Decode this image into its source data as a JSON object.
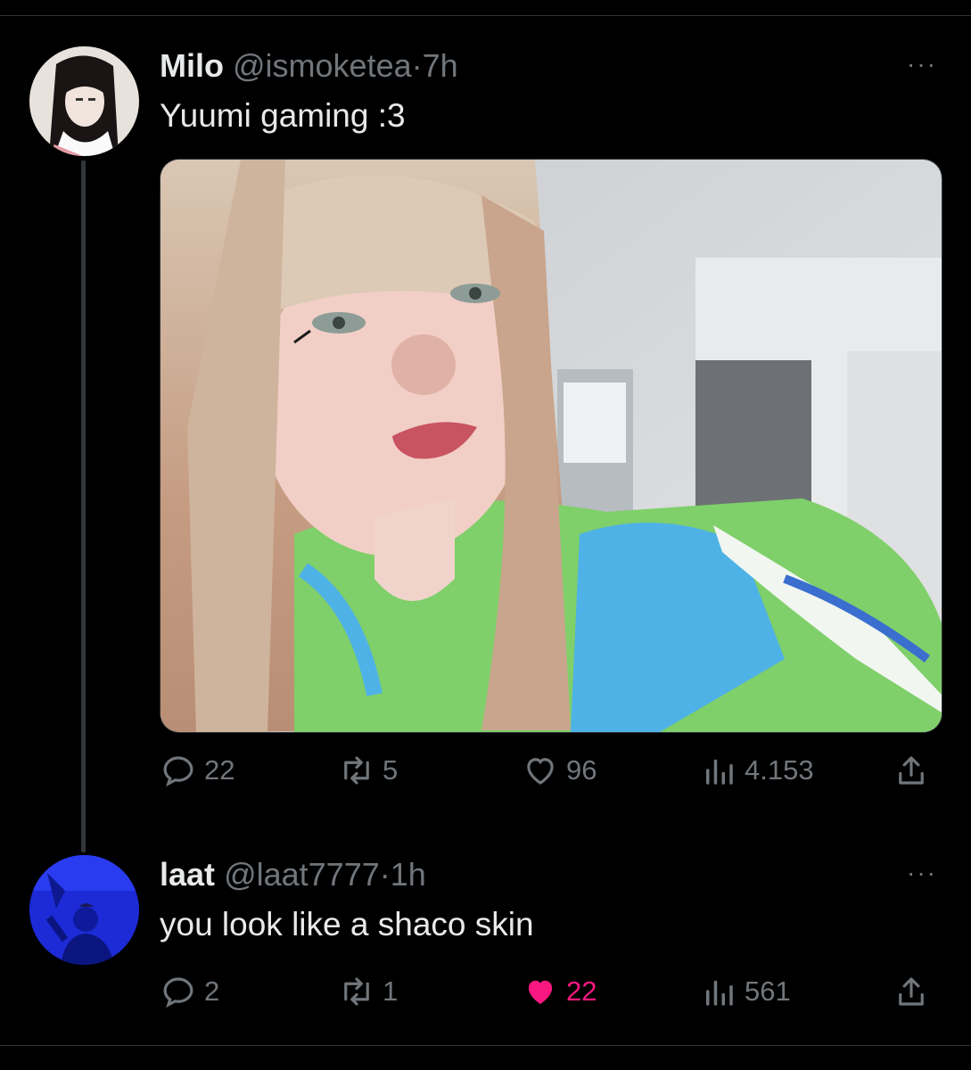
{
  "tweets": [
    {
      "name": "Milo",
      "handle": "@ismoketea",
      "separator": "·",
      "time": "7h",
      "text": "Yuumi gaming :3",
      "more": "···",
      "avatar_icon": "anime-avatar",
      "media_alt": "selfie-photo",
      "stats": {
        "replies": "22",
        "retweets": "5",
        "likes": "96",
        "views": "4.153"
      },
      "liked": false
    },
    {
      "name": "laat",
      "handle": "@laat7777",
      "separator": "·",
      "time": "1h",
      "text": "you look like a shaco skin",
      "more": "···",
      "avatar_icon": "blue-photo-avatar",
      "stats": {
        "replies": "2",
        "retweets": "1",
        "likes": "22",
        "views": "561"
      },
      "liked": true
    }
  ],
  "colors": {
    "background": "#000000",
    "text_primary": "#e7e9ea",
    "text_secondary": "#71767b",
    "like_active": "#f91880",
    "divider": "#2f3336"
  }
}
